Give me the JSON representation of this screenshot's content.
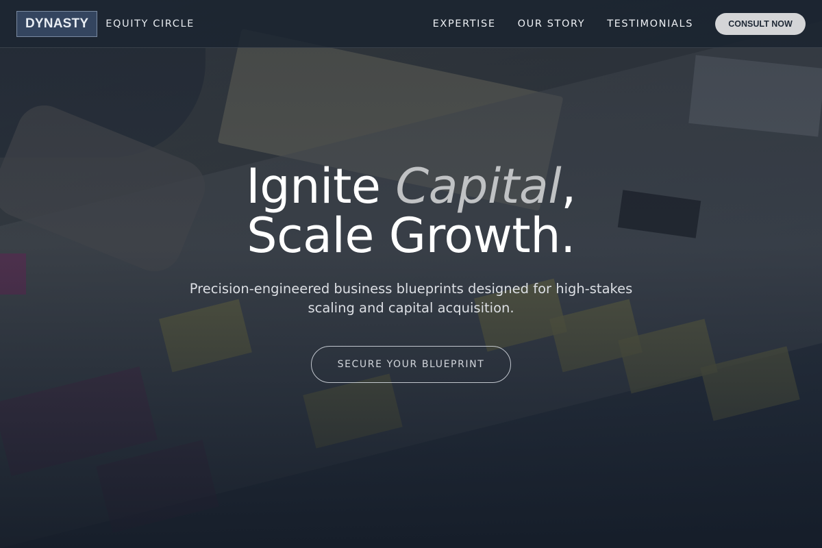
{
  "brand": {
    "logo_text": "DYNASTY",
    "subtitle": "EQUITY CIRCLE"
  },
  "nav": {
    "links": [
      "EXPERTISE",
      "OUR STORY",
      "TESTIMONIALS"
    ],
    "cta_label": "CONSULT NOW"
  },
  "hero": {
    "title_line1_plain": "Ignite ",
    "title_line1_accent": "Capital",
    "title_line1_punct": ",",
    "title_line2": "Scale Growth.",
    "subtitle": "Precision-engineered business blueprints designed for high-stakes scaling and capital acquisition.",
    "button_label": "SECURE YOUR BLUEPRINT"
  },
  "colors": {
    "overlay": "#1b2431",
    "brand_box": "#34455f",
    "cta_bg": "#d4d5d7",
    "cta_text": "#1e2835",
    "title_accent": "#c0c2c4"
  }
}
